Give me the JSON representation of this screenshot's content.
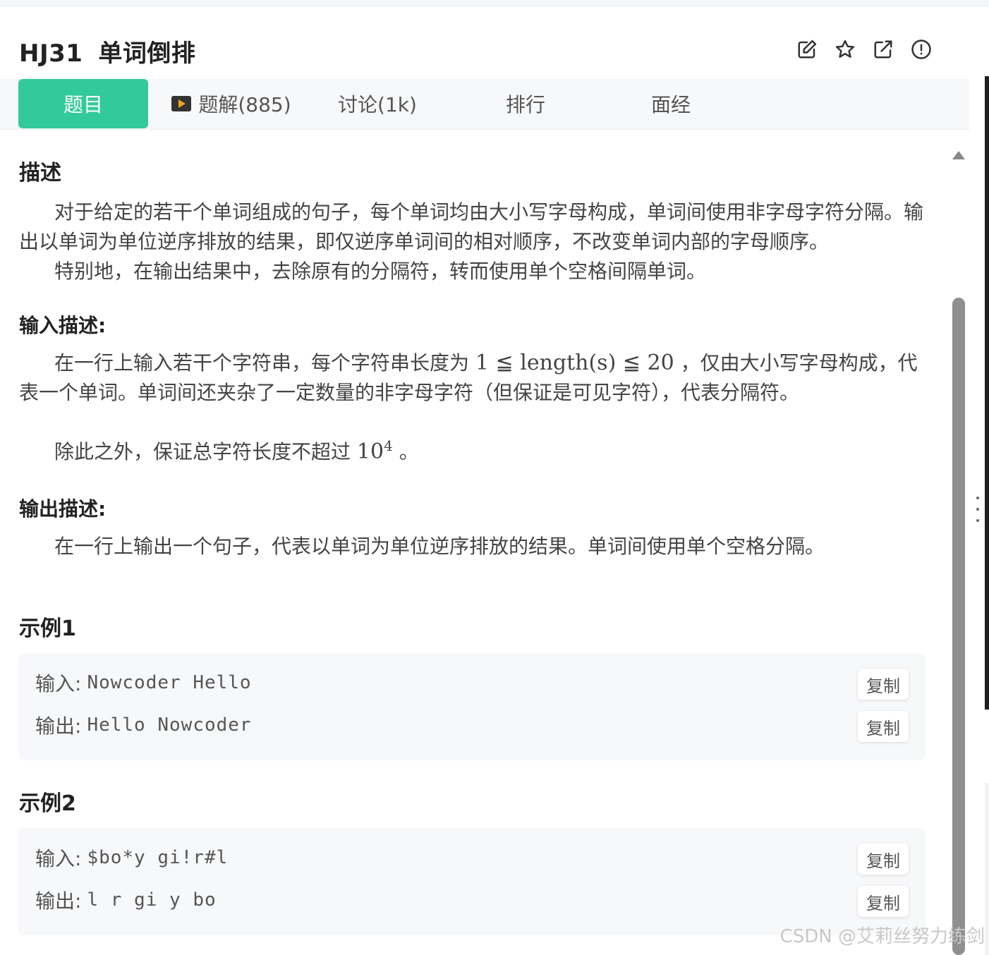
{
  "problem": {
    "code": "HJ31",
    "title": "单词倒排"
  },
  "tabs": [
    {
      "label": "题目",
      "active": true
    },
    {
      "label": "题解(885)",
      "icon": "video-play-icon"
    },
    {
      "label": "讨论(1k)"
    },
    {
      "label": "排行"
    },
    {
      "label": "面经"
    }
  ],
  "toolbar_icons": [
    "edit-icon",
    "star-icon",
    "external-link-icon",
    "report-icon"
  ],
  "description": {
    "heading": "描述",
    "p1": "对于给定的若干个单词组成的句子，每个单词均由大小写字母构成，单词间使用非字母字符分隔。输出以单词为单位逆序排放的结果，即仅逆序单词间的相对顺序，不改变单词内部的字母顺序。",
    "p2": "特别地，在输出结果中，去除原有的分隔符，转而使用单个空格间隔单词。"
  },
  "input_desc": {
    "heading": "输入描述:",
    "p1_before": "在一行上输入若干个字符串，每个字符串长度为",
    "p1_math": "1 ≦ length(s) ≦ 20",
    "p1_after": "，仅由大小写字母构成，代表一个单词。单词间还夹杂了一定数量的非字母字符（但保证是可见字符），代表分隔符。",
    "p2_before": "除此之外，保证总字符长度不超过",
    "p2_math_base": "10",
    "p2_math_exp": "4",
    "p2_after": "。"
  },
  "output_desc": {
    "heading": "输出描述:",
    "p1": "在一行上输出一个句子，代表以单词为单位逆序排放的结果。单词间使用单个空格分隔。"
  },
  "examples": [
    {
      "heading": "示例1",
      "input_label": "输入:",
      "input": "Nowcoder Hello",
      "output_label": "输出:",
      "output": "Hello Nowcoder",
      "copy_label": "复制"
    },
    {
      "heading": "示例2",
      "input_label": "输入:",
      "input": "$bo*y gi!r#l",
      "output_label": "输出:",
      "output": "l r gi y bo",
      "copy_label": "复制"
    }
  ],
  "watermark": "CSDN @艾莉丝努力练剑",
  "colors": {
    "accent": "#32ca99",
    "panel": "#f7f8fa"
  }
}
